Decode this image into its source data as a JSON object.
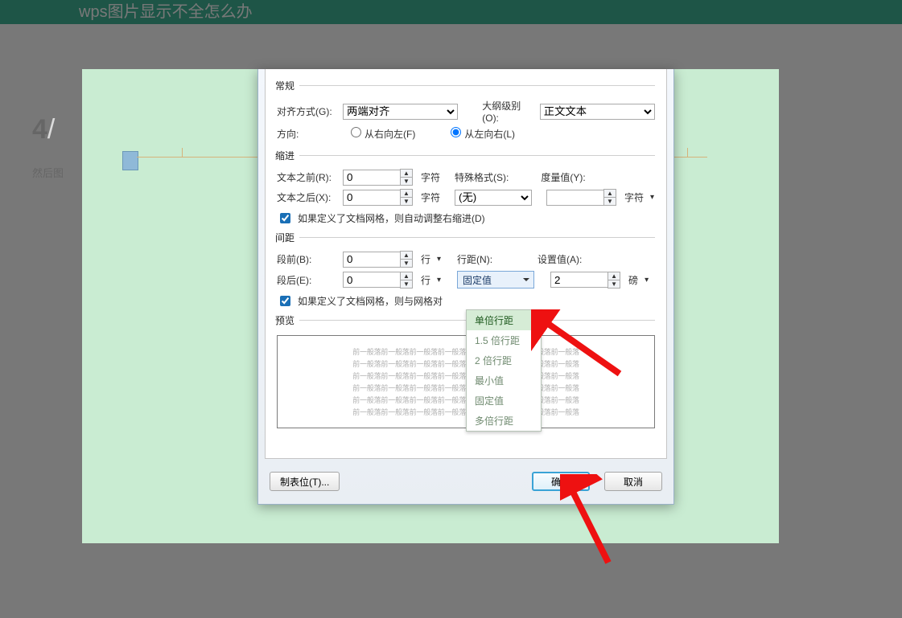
{
  "header": {
    "title": "wps图片显示不全怎么办"
  },
  "page_indicator": {
    "current": "4",
    "sep": "/"
  },
  "side_text": "然后图",
  "dialog": {
    "sections": {
      "general": {
        "legend": "常规",
        "align_label": "对齐方式(G):",
        "align_value": "两端对齐",
        "outline_label": "大纲级别(O):",
        "outline_value": "正文文本",
        "direction_label": "方向:",
        "rtl_label": "从右向左(F)",
        "ltr_label": "从左向右(L)"
      },
      "indent": {
        "legend": "缩进",
        "before_label": "文本之前(R):",
        "before_value": "0",
        "before_unit": "字符",
        "after_label": "文本之后(X):",
        "after_value": "0",
        "after_unit": "字符",
        "special_label": "特殊格式(S):",
        "special_value": "(无)",
        "metric_label": "度量值(Y):",
        "metric_value": "",
        "metric_unit": "字符",
        "auto_adjust_label": "如果定义了文档网格，则自动调整右缩进(D)"
      },
      "spacing": {
        "legend": "间距",
        "before_p_label": "段前(B):",
        "before_p_value": "0",
        "before_p_unit": "行",
        "after_p_label": "段后(E):",
        "after_p_value": "0",
        "after_p_unit": "行",
        "line_label": "行距(N):",
        "line_value": "固定值",
        "setval_label": "设置值(A):",
        "setval_value": "2",
        "setval_unit": "磅",
        "snap_label": "如果定义了文档网格，则与网格对",
        "options": [
          "单倍行距",
          "1.5 倍行距",
          "2 倍行距",
          "最小值",
          "固定值",
          "多倍行距"
        ]
      },
      "preview": {
        "legend": "预览",
        "sample": "前一般落前一般落前一般落前一般落前一般落前一般落前一般落前一般落"
      }
    },
    "buttons": {
      "tabs": "制表位(T)...",
      "ok": "确定",
      "cancel": "取消"
    }
  }
}
